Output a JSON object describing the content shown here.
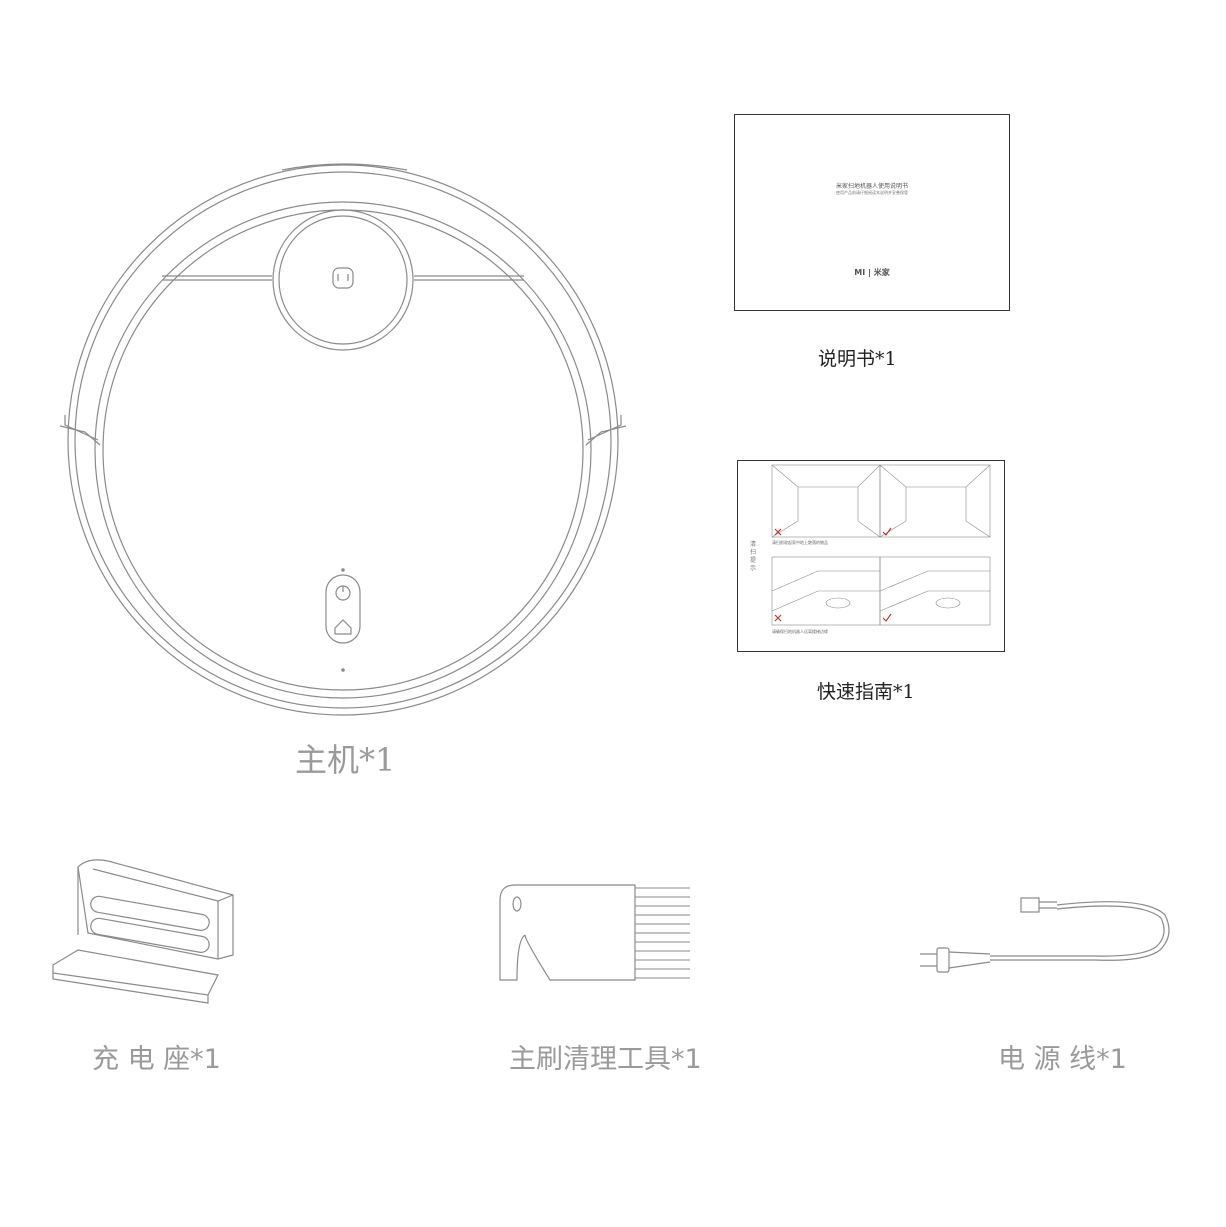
{
  "items": {
    "robot": {
      "label": "主机*1"
    },
    "manual": {
      "label": "说明书*1",
      "cover_title": "米家扫地机器人使用说明书",
      "cover_subtitle": "使用产品前请仔细阅读本说明并妥善保管",
      "brand_mark": "MI | 米家"
    },
    "quick_guide": {
      "label": "快速指南*1",
      "side_title": "清扫提示",
      "tip_line_1": "清扫前收起家中地上散落的物品",
      "tip_line_2": "请确保扫地机器人远离楼梯边缘"
    },
    "charging_dock": {
      "label": "充 电 座*1"
    },
    "brush_tool": {
      "label": "主刷清理工具*1"
    },
    "power_cord": {
      "label": "电 源 线*1"
    }
  },
  "colors": {
    "line_art": "#8a8a8a",
    "label_gray": "#9a9a9a",
    "label_dark": "#222222"
  }
}
